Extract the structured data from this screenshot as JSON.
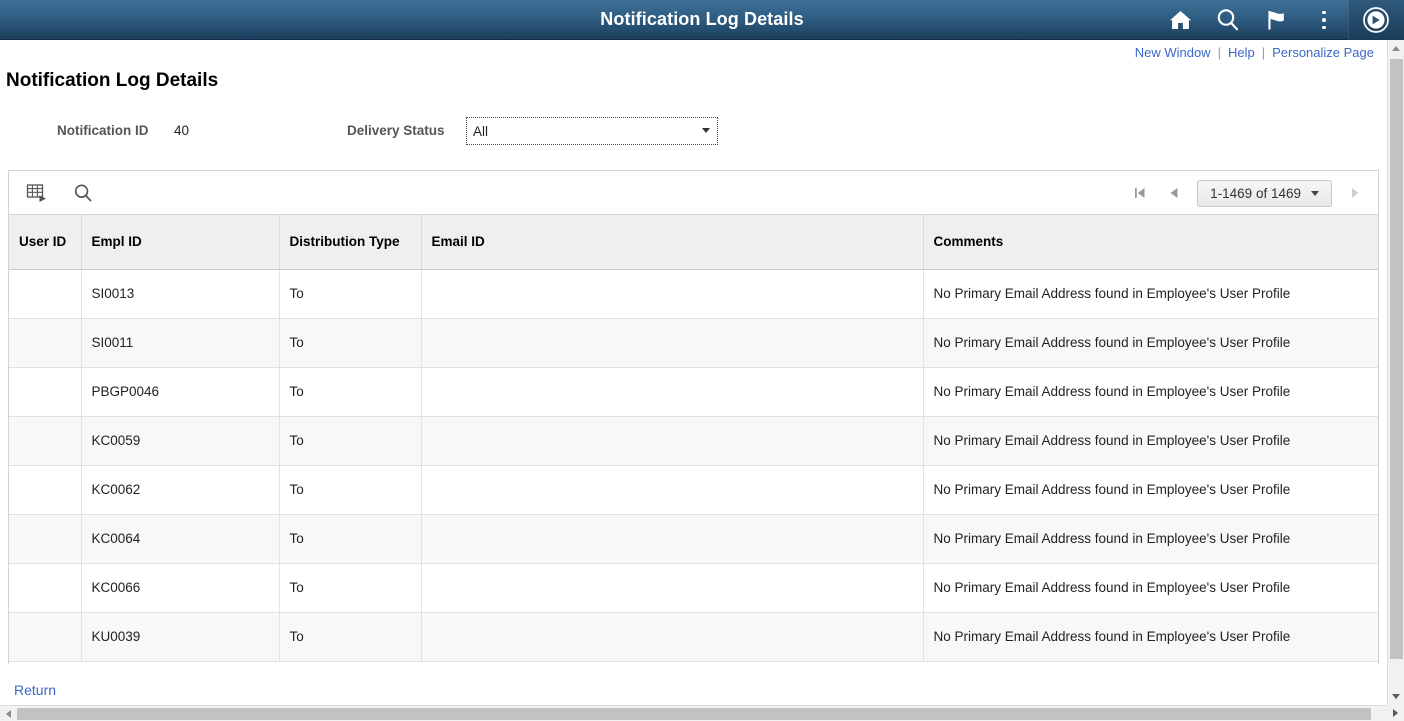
{
  "header": {
    "title": "Notification Log Details",
    "icons": [
      {
        "name": "home-icon",
        "label": "Home"
      },
      {
        "name": "search-icon",
        "label": "Search"
      },
      {
        "name": "flag-icon",
        "label": "Notifications"
      },
      {
        "name": "kebab-menu-icon",
        "label": "Actions"
      },
      {
        "name": "navbar-compass-icon",
        "label": "NavBar"
      }
    ],
    "accent_color": "#336288",
    "gradient_top": "#3e6f93",
    "gradient_bottom": "#1d3f5d"
  },
  "sublinks": {
    "new_window": "New Window",
    "help": "Help",
    "personalize_page": "Personalize Page",
    "separator": "|",
    "link_color": "#3b67c8"
  },
  "page": {
    "title": "Notification Log Details"
  },
  "form": {
    "notification_id_label": "Notification ID",
    "notification_id_value": "40",
    "delivery_status_label": "Delivery Status",
    "delivery_status_value": "All",
    "delivery_status_options": [
      "All"
    ]
  },
  "grid": {
    "toolbar": {
      "download_icon": "download-to-spreadsheet-icon",
      "find_icon": "find-search-icon"
    },
    "pager": {
      "first_label": "First",
      "previous_label": "Previous",
      "range_text": "1-1469 of 1469",
      "next_label": "Next",
      "last_label": "Last"
    },
    "columns": [
      {
        "key": "user_id",
        "label": "User ID"
      },
      {
        "key": "empl_id",
        "label": "Empl ID"
      },
      {
        "key": "distribution_type",
        "label": "Distribution Type"
      },
      {
        "key": "email_id",
        "label": "Email ID"
      },
      {
        "key": "comments",
        "label": "Comments"
      }
    ],
    "rows": [
      {
        "user_id": "",
        "empl_id": "SI0013",
        "distribution_type": "To",
        "email_id": "",
        "comments": "No Primary Email Address found in Employee's User Profile"
      },
      {
        "user_id": "",
        "empl_id": "SI0011",
        "distribution_type": "To",
        "email_id": "",
        "comments": "No Primary Email Address found in Employee's User Profile"
      },
      {
        "user_id": "",
        "empl_id": "PBGP0046",
        "distribution_type": "To",
        "email_id": "",
        "comments": "No Primary Email Address found in Employee's User Profile"
      },
      {
        "user_id": "",
        "empl_id": "KC0059",
        "distribution_type": "To",
        "email_id": "",
        "comments": "No Primary Email Address found in Employee's User Profile"
      },
      {
        "user_id": "",
        "empl_id": "KC0062",
        "distribution_type": "To",
        "email_id": "",
        "comments": "No Primary Email Address found in Employee's User Profile"
      },
      {
        "user_id": "",
        "empl_id": "KC0064",
        "distribution_type": "To",
        "email_id": "",
        "comments": "No Primary Email Address found in Employee's User Profile"
      },
      {
        "user_id": "",
        "empl_id": "KC0066",
        "distribution_type": "To",
        "email_id": "",
        "comments": "No Primary Email Address found in Employee's User Profile"
      },
      {
        "user_id": "",
        "empl_id": "KU0039",
        "distribution_type": "To",
        "email_id": "",
        "comments": "No Primary Email Address found in Employee's User Profile"
      }
    ]
  },
  "footer": {
    "return_label": "Return"
  }
}
